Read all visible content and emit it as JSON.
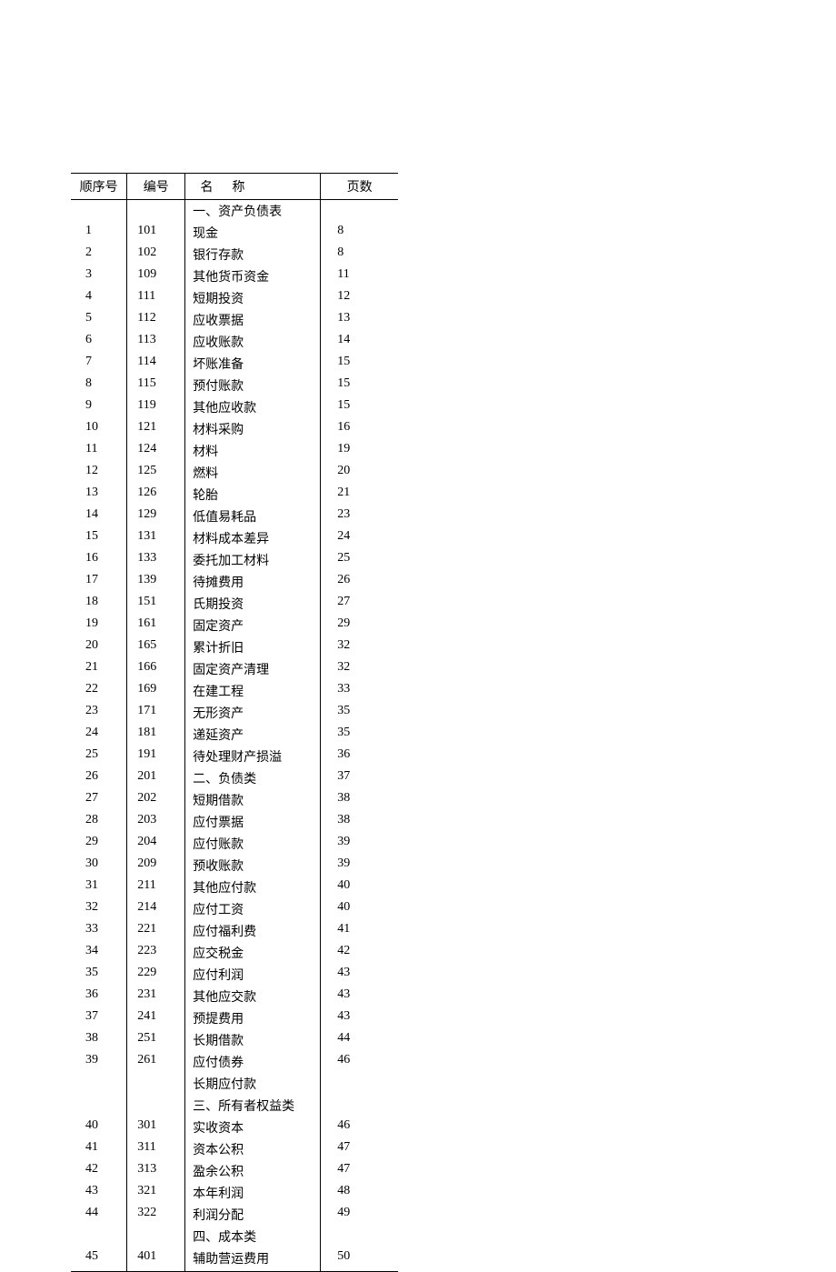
{
  "headers": {
    "seq": "顺序号",
    "code": "编号",
    "name": "名称",
    "page": "页数"
  },
  "rows": [
    {
      "seq": "",
      "code": "",
      "name": "一、资产负债表",
      "page": ""
    },
    {
      "seq": "1",
      "code": "101",
      "name": "现金",
      "page": "8"
    },
    {
      "seq": "2",
      "code": "102",
      "name": "银行存款",
      "page": "8"
    },
    {
      "seq": "3",
      "code": "109",
      "name": "其他货币资金",
      "page": "11"
    },
    {
      "seq": "4",
      "code": "111",
      "name": "短期投资",
      "page": "12"
    },
    {
      "seq": "5",
      "code": "112",
      "name": "应收票据",
      "page": "13"
    },
    {
      "seq": "6",
      "code": "113",
      "name": "应收账款",
      "page": "14"
    },
    {
      "seq": "7",
      "code": "114",
      "name": "坏账准备",
      "page": "15"
    },
    {
      "seq": "8",
      "code": "115",
      "name": "预付账款",
      "page": "15"
    },
    {
      "seq": "9",
      "code": "119",
      "name": "其他应收款",
      "page": "15"
    },
    {
      "seq": "10",
      "code": "121",
      "name": "材料采购",
      "page": "16"
    },
    {
      "seq": "11",
      "code": "124",
      "name": "材料",
      "page": "19"
    },
    {
      "seq": "12",
      "code": "125",
      "name": "燃料",
      "page": "20"
    },
    {
      "seq": "13",
      "code": "126",
      "name": "轮胎",
      "page": "21"
    },
    {
      "seq": "14",
      "code": "129",
      "name": "低值易耗品",
      "page": "23"
    },
    {
      "seq": "15",
      "code": "131",
      "name": "材料成本差异",
      "page": "24"
    },
    {
      "seq": "16",
      "code": "133",
      "name": "委托加工材料",
      "page": "25"
    },
    {
      "seq": "17",
      "code": "139",
      "name": "待摊费用",
      "page": "26"
    },
    {
      "seq": "18",
      "code": "151",
      "name": "氏期投资",
      "page": "27"
    },
    {
      "seq": "19",
      "code": "161",
      "name": "固定资产",
      "page": "29"
    },
    {
      "seq": "20",
      "code": "165",
      "name": "累计折旧",
      "page": "32"
    },
    {
      "seq": "21",
      "code": "166",
      "name": "固定资产清理",
      "page": "32"
    },
    {
      "seq": "22",
      "code": "169",
      "name": "在建工程",
      "page": "33"
    },
    {
      "seq": "23",
      "code": "171",
      "name": "无形资产",
      "page": "35"
    },
    {
      "seq": "24",
      "code": "181",
      "name": "递延资产",
      "page": "35"
    },
    {
      "seq": "25",
      "code": "191",
      "name": "待处理财产损溢",
      "page": "36"
    },
    {
      "seq": "26",
      "code": "201",
      "name": "二、负债类",
      "page": "37"
    },
    {
      "seq": "27",
      "code": "202",
      "name": "短期借款",
      "page": "38"
    },
    {
      "seq": "28",
      "code": "203",
      "name": "应付票据",
      "page": "38"
    },
    {
      "seq": "29",
      "code": "204",
      "name": "应付账款",
      "page": "39"
    },
    {
      "seq": "30",
      "code": "209",
      "name": "预收账款",
      "page": "39"
    },
    {
      "seq": "31",
      "code": "211",
      "name": "其他应付款",
      "page": "40"
    },
    {
      "seq": "32",
      "code": "214",
      "name": "应付工资",
      "page": "40"
    },
    {
      "seq": "33",
      "code": "221",
      "name": "应付福利费",
      "page": "41"
    },
    {
      "seq": "34",
      "code": "223",
      "name": "应交税金",
      "page": "42"
    },
    {
      "seq": "35",
      "code": "229",
      "name": "应付利润",
      "page": "43"
    },
    {
      "seq": "36",
      "code": "231",
      "name": "其他应交款",
      "page": "43"
    },
    {
      "seq": "37",
      "code": "241",
      "name": "预提费用",
      "page": "43"
    },
    {
      "seq": "38",
      "code": "251",
      "name": "长期借款",
      "page": "44"
    },
    {
      "seq": "39",
      "code": "261",
      "name": "应付债券",
      "page": "46"
    },
    {
      "seq": "",
      "code": "",
      "name": "长期应付款",
      "page": ""
    },
    {
      "seq": "",
      "code": "",
      "name": "三、所有者权益类",
      "page": ""
    },
    {
      "seq": "40",
      "code": "301",
      "name": "实收资本",
      "page": "46"
    },
    {
      "seq": "41",
      "code": "311",
      "name": "资本公积",
      "page": "47"
    },
    {
      "seq": "42",
      "code": "313",
      "name": "盈余公积",
      "page": "47"
    },
    {
      "seq": "43",
      "code": "321",
      "name": "本年利润",
      "page": "48"
    },
    {
      "seq": "44",
      "code": "322",
      "name": "利润分配",
      "page": "49"
    },
    {
      "seq": "",
      "code": "",
      "name": "四、成本类",
      "page": ""
    },
    {
      "seq": "45",
      "code": "401",
      "name": "辅助营运费用",
      "page": "50"
    }
  ]
}
